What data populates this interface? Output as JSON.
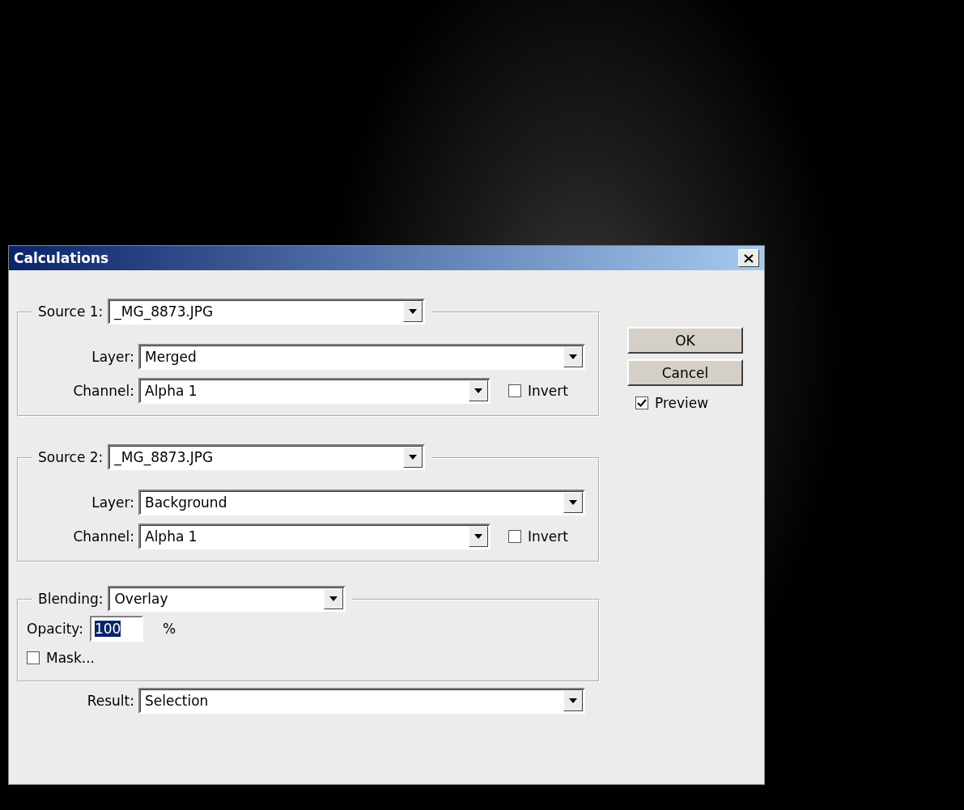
{
  "window": {
    "title": "Calculations"
  },
  "source_1": {
    "label": "Source 1:",
    "file": "_MG_8873.JPG",
    "layer_label": "Layer:",
    "layer": "Merged",
    "channel_label": "Channel:",
    "channel": "Alpha 1",
    "invert": {
      "label": "Invert",
      "checked": false
    }
  },
  "source_2": {
    "label": "Source 2:",
    "file": "_MG_8873.JPG",
    "layer_label": "Layer:",
    "layer": "Background",
    "channel_label": "Channel:",
    "channel": "Alpha 1",
    "invert": {
      "label": "Invert",
      "checked": false
    }
  },
  "blending": {
    "label": "Blending:",
    "value": "Overlay",
    "opacity_label": "Opacity:",
    "opacity": "100",
    "opacity_text_selected": true,
    "opacity_unit": "%",
    "mask": {
      "label": "Mask...",
      "checked": false
    }
  },
  "result": {
    "label": "Result:",
    "value": "Selection"
  },
  "buttons": [
    "OK",
    "Cancel"
  ],
  "preview": {
    "label": "Preview",
    "checked": true
  }
}
